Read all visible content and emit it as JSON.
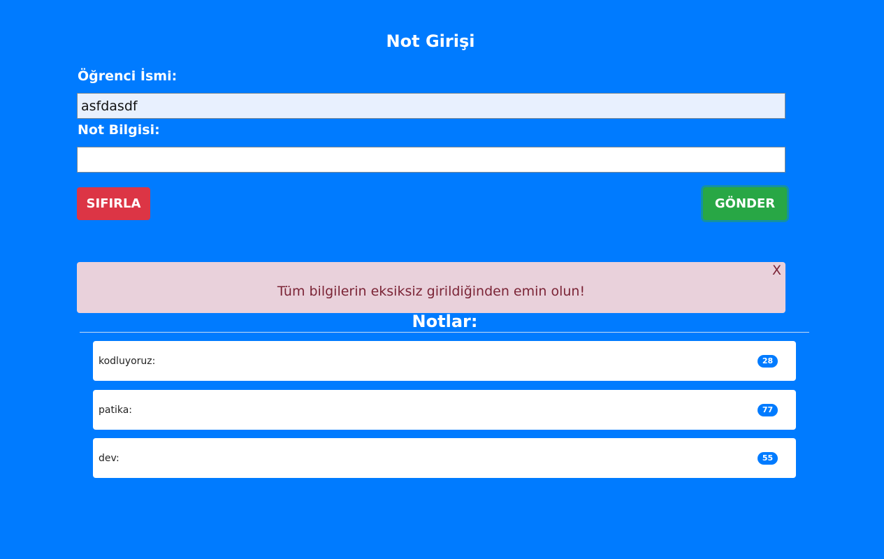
{
  "form": {
    "title": "Not Girişi",
    "student_name_label": "Öğrenci İsmi:",
    "student_name_value": "asfdasdf",
    "grade_label": "Not Bilgisi:",
    "grade_value": "",
    "reset_label": "SIFIRLA",
    "submit_label": "GÖNDER"
  },
  "alert": {
    "message": "Tüm bilgilerin eksiksiz girildiğinden emin olun!",
    "close_label": "X"
  },
  "notes": {
    "title": "Notlar:",
    "items": [
      {
        "label": "kodluyoruz:",
        "value": "28"
      },
      {
        "label": "patika:",
        "value": "77"
      },
      {
        "label": "dev:",
        "value": "55"
      }
    ]
  },
  "colors": {
    "background": "#007bff",
    "reset_button": "#dc3545",
    "submit_button": "#28a745",
    "alert_background": "#e9d1db",
    "alert_text": "#7b2436",
    "badge": "#007bff"
  }
}
